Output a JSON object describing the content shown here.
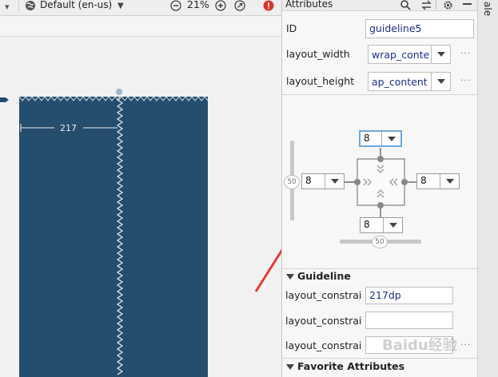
{
  "toolbar": {
    "locale_label": "Default (en-us)",
    "zoom_label": "21%"
  },
  "canvas": {
    "guideline_distance": "217"
  },
  "panel": {
    "title": "Attributes",
    "side_label": "ale",
    "id_label": "ID",
    "id_value": "guideline5",
    "layout_width_label": "layout_width",
    "layout_width_value": "wrap_conte",
    "layout_height_label": "layout_height",
    "layout_height_value": "ap_content",
    "more_dots": "···"
  },
  "constraint_widget": {
    "top_margin": "8",
    "left_margin": "8",
    "right_margin": "8",
    "bottom_margin": "8",
    "vertical_bias": "50",
    "horizontal_bias": "50"
  },
  "guideline_section": {
    "title": "Guideline",
    "rows": [
      {
        "label": "layout_constraint",
        "value": "217dp"
      },
      {
        "label": "layout_constraint",
        "value": ""
      },
      {
        "label": "layout_constraint",
        "value": ""
      }
    ]
  },
  "favorites_section": {
    "title": "Favorite Attributes"
  },
  "watermark": "Baidu经验",
  "colors": {
    "device_bg": "#254d6e",
    "field_text": "#1a2d8f",
    "arrow": "#e53935",
    "selected_border": "#6fa8dc"
  }
}
